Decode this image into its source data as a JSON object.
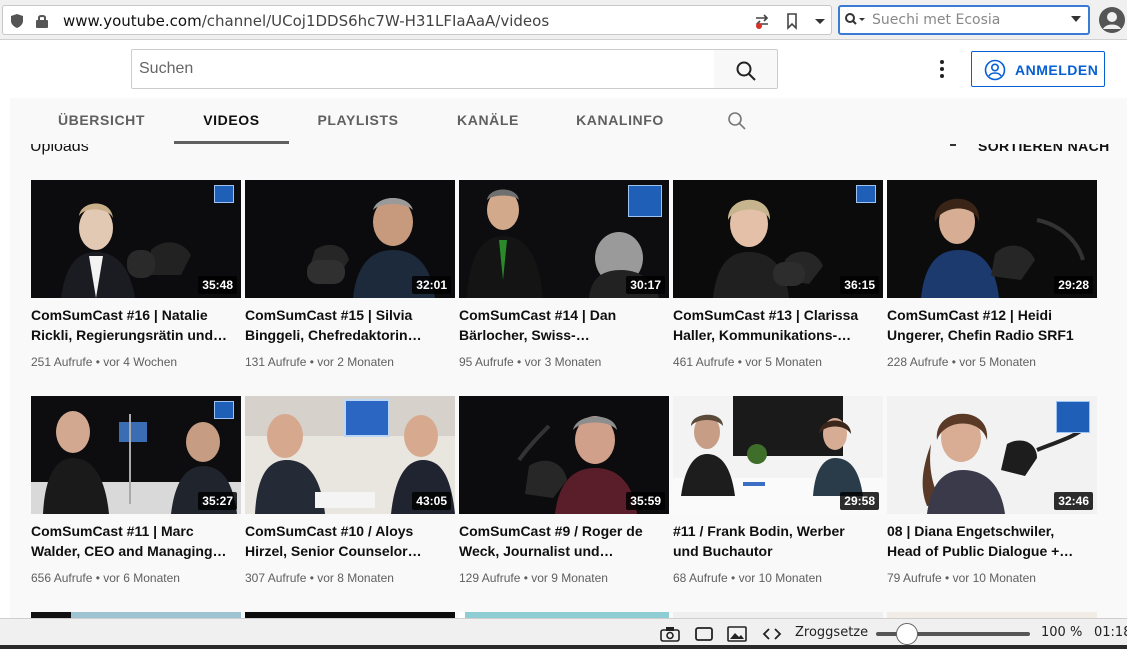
{
  "browser": {
    "url_host": "www.youtube.com",
    "url_path": "/channel/UCoj1DDS6hc7W-H31LFIaAaA/videos",
    "search_placeholder": "Suechi met Ecosia"
  },
  "masthead": {
    "search_placeholder": "Suchen",
    "signin_label": "ANMELDEN"
  },
  "tabs": [
    {
      "label": "ÜBERSICHT"
    },
    {
      "label": "VIDEOS"
    },
    {
      "label": "PLAYLISTS"
    },
    {
      "label": "KANÄLE"
    },
    {
      "label": "KANALINFO"
    }
  ],
  "section": {
    "title": "Uploads",
    "sort_label": "SORTIEREN NACH"
  },
  "videos": [
    {
      "title1": "ComSumCast #16 | Natalie",
      "title2": "Rickli, Regierungsrätin und…",
      "duration": "35:48",
      "meta": "251 Aufrufe • vor 4 Wochen"
    },
    {
      "title1": "ComSumCast #15 | Silvia",
      "title2": "Binggeli, Chefredaktorin…",
      "duration": "32:01",
      "meta": "131 Aufrufe • vor 2 Monaten"
    },
    {
      "title1": "ComSumCast #14 | Dan",
      "title2": "Bärlocher, Swiss-…",
      "duration": "30:17",
      "meta": "95 Aufrufe • vor 3 Monaten"
    },
    {
      "title1": "ComSumCast #13 | Clarissa",
      "title2": "Haller, Kommunikations-…",
      "duration": "36:15",
      "meta": "461 Aufrufe • vor 5 Monaten"
    },
    {
      "title1": "ComSumCast #12 | Heidi",
      "title2": "Ungerer, Chefin Radio SRF1",
      "duration": "29:28",
      "meta": "228 Aufrufe • vor 5 Monaten"
    },
    {
      "title1": "ComSumCast #11 | Marc",
      "title2": "Walder, CEO and Managing…",
      "duration": "35:27",
      "meta": "656 Aufrufe • vor 6 Monaten"
    },
    {
      "title1": "ComSumCast #10 / Aloys",
      "title2": "Hirzel, Senior Counselor…",
      "duration": "43:05",
      "meta": "307 Aufrufe • vor 8 Monaten"
    },
    {
      "title1": "ComSumCast #9 / Roger de",
      "title2": "Weck, Journalist und…",
      "duration": "35:59",
      "meta": "129 Aufrufe • vor 9 Monaten"
    },
    {
      "title1": "#11 / Frank Bodin, Werber",
      "title2": "und Buchautor",
      "duration": "29:58",
      "meta": "68 Aufrufe • vor 10 Monaten"
    },
    {
      "title1": "08 | Diana Engetschwiler,",
      "title2": "Head of Public Dialogue +…",
      "duration": "32:46",
      "meta": "79 Aufrufe • vor 10 Monaten"
    }
  ],
  "statusbar": {
    "zoom_label": "Zroggsetze",
    "zoom_pct": "100 %",
    "clock": "01:18"
  }
}
